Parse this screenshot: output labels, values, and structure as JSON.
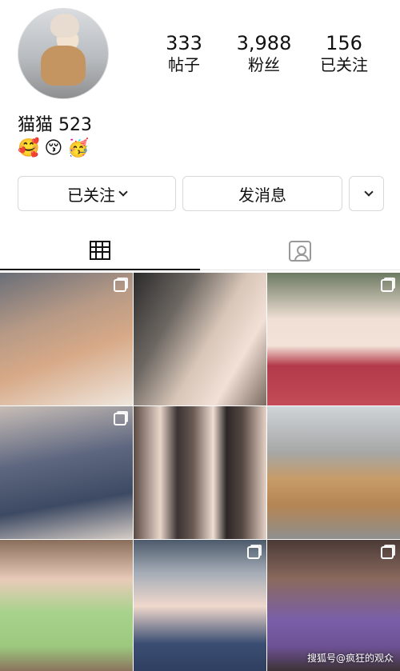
{
  "profile": {
    "username": "猫猫 523",
    "emojis": [
      "🥰",
      "😚",
      "🥳"
    ]
  },
  "stats": [
    {
      "value": "333",
      "label": "帖子"
    },
    {
      "value": "3,988",
      "label": "粉丝"
    },
    {
      "value": "156",
      "label": "已关注"
    }
  ],
  "actions": {
    "following_label": "已关注",
    "message_label": "发消息"
  },
  "tabs": {
    "grid": "grid-icon",
    "tagged": "tagged-icon"
  },
  "posts": [
    {
      "kind": "photo",
      "multi": true
    },
    {
      "kind": "photo",
      "multi": false
    },
    {
      "kind": "photo",
      "multi": true
    },
    {
      "kind": "photo",
      "multi": true
    },
    {
      "kind": "photo",
      "multi": false
    },
    {
      "kind": "photo",
      "multi": false
    },
    {
      "kind": "photo",
      "multi": false
    },
    {
      "kind": "photo",
      "multi": true
    },
    {
      "kind": "photo",
      "multi": true
    }
  ],
  "watermark": "搜狐号@疯狂的观众"
}
